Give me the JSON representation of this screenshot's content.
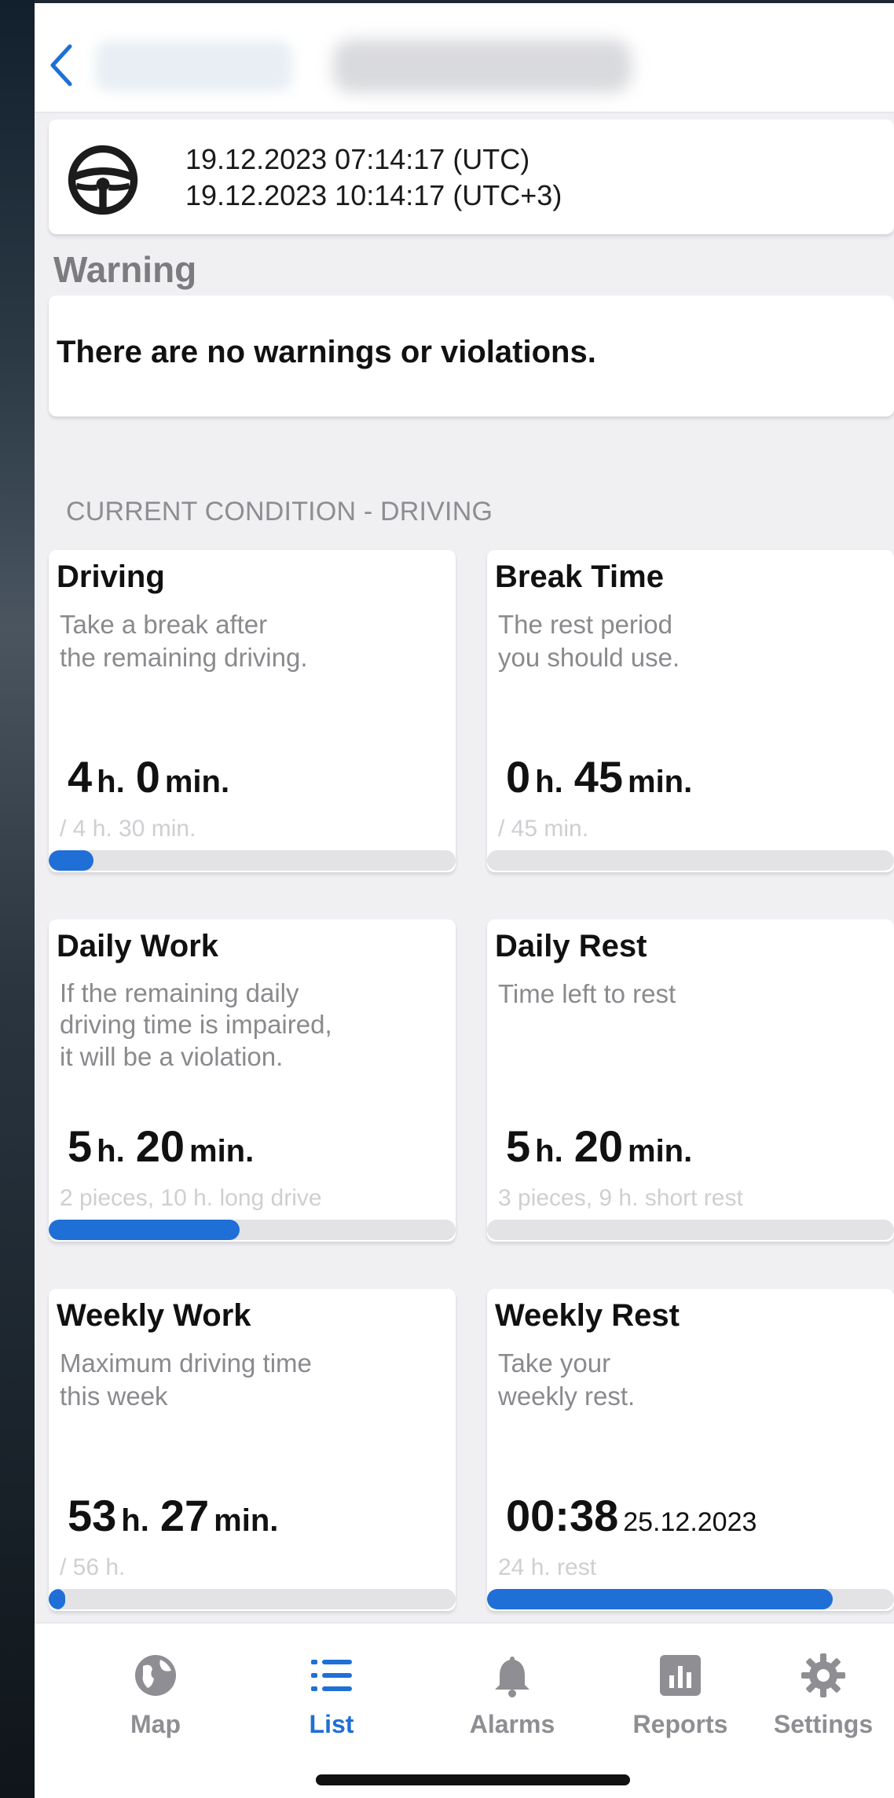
{
  "header": {
    "back_icon": "chevron-left-icon"
  },
  "time": {
    "icon": "steering-wheel-icon",
    "utc": "19.12.2023 07:14:17 (UTC)",
    "local": "19.12.2023 10:14:17 (UTC+3)"
  },
  "warning": {
    "title": "Warning",
    "text": "There are no warnings or violations."
  },
  "condition_label": "CURRENT CONDITION - DRIVING",
  "tiles": {
    "driving": {
      "title": "Driving",
      "desc1": "Take a break after",
      "desc2": "the remaining driving.",
      "hours": "4",
      "h_unit": "h.",
      "minutes": "0",
      "m_unit": "min.",
      "sub": "/ 4 h. 30 min.",
      "progress": 0.11
    },
    "break_time": {
      "title": "Break Time",
      "desc1": "The rest period",
      "desc2": "you should use.",
      "hours": "0",
      "h_unit": "h.",
      "minutes": "45",
      "m_unit": "min.",
      "sub": "/ 45 min.",
      "progress": 0.0
    },
    "daily_work": {
      "title": "Daily Work",
      "desc1": "If the remaining daily",
      "desc2": "driving time is impaired,",
      "desc3": "it will be a violation.",
      "hours": "5",
      "h_unit": "h.",
      "minutes": "20",
      "m_unit": "min.",
      "sub": "2 pieces, 10 h. long drive",
      "progress": 0.47
    },
    "daily_rest": {
      "title": "Daily Rest",
      "desc1": "Time left to rest",
      "hours": "5",
      "h_unit": "h.",
      "minutes": "20",
      "m_unit": "min.",
      "sub": "3 pieces, 9 h. short rest",
      "progress": 0.0
    },
    "weekly_work": {
      "title": "Weekly Work",
      "desc1": "Maximum driving time",
      "desc2": "this week",
      "hours": "53",
      "h_unit": "h.",
      "minutes": "27",
      "m_unit": "min.",
      "sub": "/ 56 h.",
      "progress": 0.04
    },
    "weekly_rest": {
      "title": "Weekly Rest",
      "desc1": "Take your",
      "desc2": "weekly rest.",
      "time": "00:38",
      "date": "25.12.2023",
      "sub": "24 h. rest",
      "progress": 0.85
    }
  },
  "tabs": [
    {
      "label": "Map",
      "icon": "globe-icon",
      "active": false
    },
    {
      "label": "List",
      "icon": "list-icon",
      "active": true
    },
    {
      "label": "Alarms",
      "icon": "bell-icon",
      "active": false
    },
    {
      "label": "Reports",
      "icon": "bar-chart-icon",
      "active": false
    },
    {
      "label": "Settings",
      "icon": "gear-icon",
      "active": false
    }
  ],
  "colors": {
    "accent": "#1f6fd6",
    "muted": "#8a8a8e",
    "background": "#f0f0f3"
  }
}
